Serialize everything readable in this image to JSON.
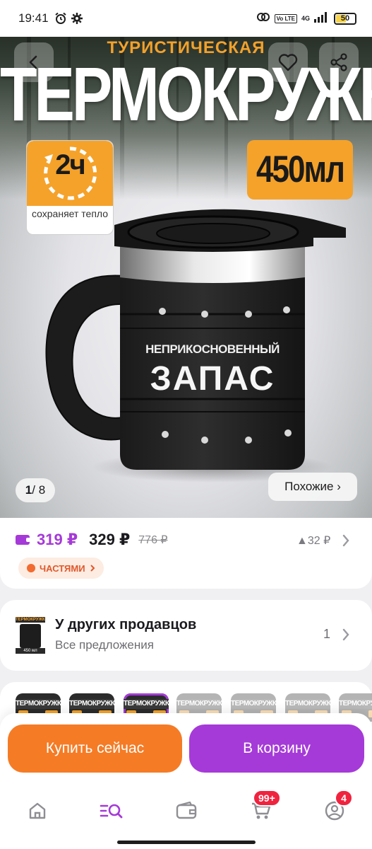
{
  "status_bar": {
    "time": "19:41",
    "volte": "Vo LTE",
    "network": "4G",
    "battery": "50"
  },
  "hero": {
    "subtitle": "ТУРИСТИЧЕСКАЯ",
    "title": "ТЕРМОКРУЖКА",
    "badge_hours": "2ч",
    "badge_hours_caption": "сохраняет тепло",
    "badge_volume": "450мл",
    "mug_text_small": "НЕПРИКОСНОВЕННЫЙ",
    "mug_text_big": "ЗАПАС",
    "pager_current": "1",
    "pager_separator": "/ ",
    "pager_total": "8",
    "similar_label": "Похожие ›"
  },
  "price": {
    "wallet_price": "319 ₽",
    "price": "329 ₽",
    "old_price": "776 ₽",
    "delta": "▲32 ₽",
    "installments_label": "ЧАСТЯМИ"
  },
  "sellers": {
    "title": "У других продавцов",
    "subtitle": "Все предложения",
    "count": "1",
    "thumb_title": "ТЕРМОКРУЖКА",
    "thumb_volume": "450 мл"
  },
  "variants": [
    {
      "label": "ТЕРМОКРУЖКА",
      "state": "normal"
    },
    {
      "label": "ТЕРМОКРУЖКА",
      "state": "normal"
    },
    {
      "label": "ТЕРМОКРУЖКА",
      "state": "selected"
    },
    {
      "label": "ТЕРМОКРУЖКА",
      "state": "faded"
    },
    {
      "label": "ТЕРМОКРУЖКА",
      "state": "faded"
    },
    {
      "label": "ТЕРМОКРУЖКА",
      "state": "faded"
    },
    {
      "label": "ТЕРМОКРУЖКА",
      "state": "faded"
    }
  ],
  "actions": {
    "buy_now": "Купить сейчас",
    "add_to_cart": "В корзину"
  },
  "tabbar": {
    "items": [
      {
        "name": "home-icon"
      },
      {
        "name": "catalog-icon"
      },
      {
        "name": "wallet-icon"
      },
      {
        "name": "cart-icon",
        "badge": "99+"
      },
      {
        "name": "profile-icon",
        "badge": "4"
      }
    ]
  },
  "colors": {
    "accent_purple": "#a53ad8",
    "accent_orange": "#f57b25",
    "badge_red": "#f0233f"
  }
}
